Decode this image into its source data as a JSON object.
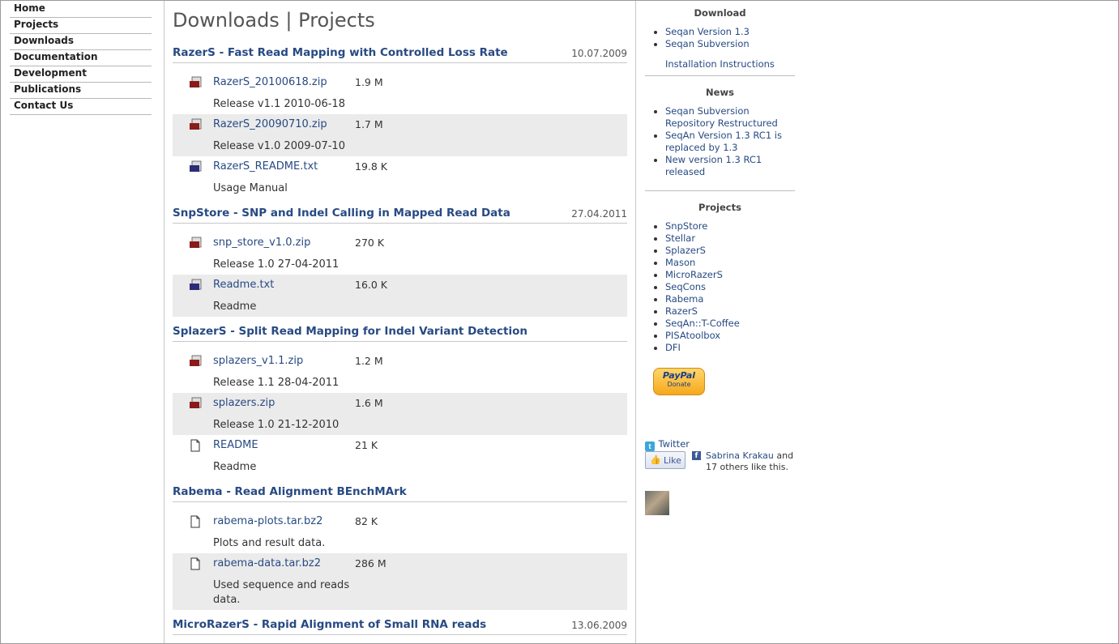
{
  "nav": {
    "items": [
      {
        "label": "Home"
      },
      {
        "label": "Projects"
      },
      {
        "label": "Downloads"
      },
      {
        "label": "Documentation"
      },
      {
        "label": "Development"
      },
      {
        "label": "Publications"
      },
      {
        "label": "Contact Us"
      }
    ]
  },
  "main": {
    "title": "Downloads | Projects",
    "projects": [
      {
        "title": "RazerS - Fast Read Mapping with Controlled Loss Rate",
        "date": "10.07.2009",
        "files": [
          {
            "name": "RazerS_20100618.zip",
            "size": "1.9 M",
            "desc": "Release v1.1 2010-06-18",
            "icon": "zip-icon"
          },
          {
            "name": "RazerS_20090710.zip",
            "size": "1.7 M",
            "desc": "Release v1.0 2009-07-10",
            "icon": "zip-icon"
          },
          {
            "name": "RazerS_README.txt",
            "size": "19.8 K",
            "desc": "Usage Manual",
            "icon": "txt-icon"
          }
        ]
      },
      {
        "title": "SnpStore - SNP and Indel Calling in Mapped Read Data",
        "date": "27.04.2011",
        "files": [
          {
            "name": "snp_store_v1.0.zip",
            "size": "270 K",
            "desc": "Release 1.0 27-04-2011",
            "icon": "zip-icon"
          },
          {
            "name": "Readme.txt",
            "size": "16.0 K",
            "desc": "Readme",
            "icon": "txt-icon"
          }
        ]
      },
      {
        "title": "SplazerS - Split Read Mapping for Indel Variant Detection",
        "date": "",
        "files": [
          {
            "name": "splazers_v1.1.zip",
            "size": "1.2 M",
            "desc": "Release 1.1 28-04-2011",
            "icon": "zip-icon"
          },
          {
            "name": "splazers.zip",
            "size": "1.6 M",
            "desc": "Release 1.0 21-12-2010",
            "icon": "zip-icon"
          },
          {
            "name": "README",
            "size": "21 K",
            "desc": "Readme",
            "icon": "file-icon"
          }
        ]
      },
      {
        "title": "Rabema - Read Alignment BEnchMArk",
        "date": "",
        "files": [
          {
            "name": "rabema-plots.tar.bz2",
            "size": "82 K",
            "desc": "Plots and result data.",
            "icon": "file-icon"
          },
          {
            "name": "rabema-data.tar.bz2",
            "size": "286 M",
            "desc": "Used sequence and reads data.",
            "icon": "file-icon"
          }
        ]
      },
      {
        "title": "MicroRazerS - Rapid Alignment of Small RNA reads",
        "date": "13.06.2009",
        "files": []
      }
    ]
  },
  "sidebar": {
    "download": {
      "heading": "Download",
      "items": [
        "Seqan Version 1.3",
        "Seqan Subversion"
      ],
      "install_link": "Installation Instructions"
    },
    "news": {
      "heading": "News",
      "items": [
        "Seqan Subversion Repository Restructured",
        "SeqAn Version 1.3 RC1 is replaced by 1.3",
        "New version 1.3 RC1 released"
      ]
    },
    "projects": {
      "heading": "Projects",
      "items": [
        "SnpStore",
        "Stellar",
        "SplazerS",
        "Mason",
        "MicroRazerS",
        "SeqCons",
        "Rabema",
        "RazerS",
        "SeqAn::T-Coffee",
        "PISAtoolbox",
        "DFI"
      ]
    },
    "paypal": {
      "brand": "PayPal",
      "label": "Donate"
    },
    "social": {
      "twitter_label": "Twitter",
      "like_label": "Like",
      "liker_name": "Sabrina Krakau",
      "liker_suffix": " and",
      "others_text": "17 others like this."
    }
  },
  "colors": {
    "link": "#274a83",
    "shade": "#ebebeb",
    "zip_icon": "#8b1a1a",
    "txt_icon": "#2c2c7a"
  }
}
